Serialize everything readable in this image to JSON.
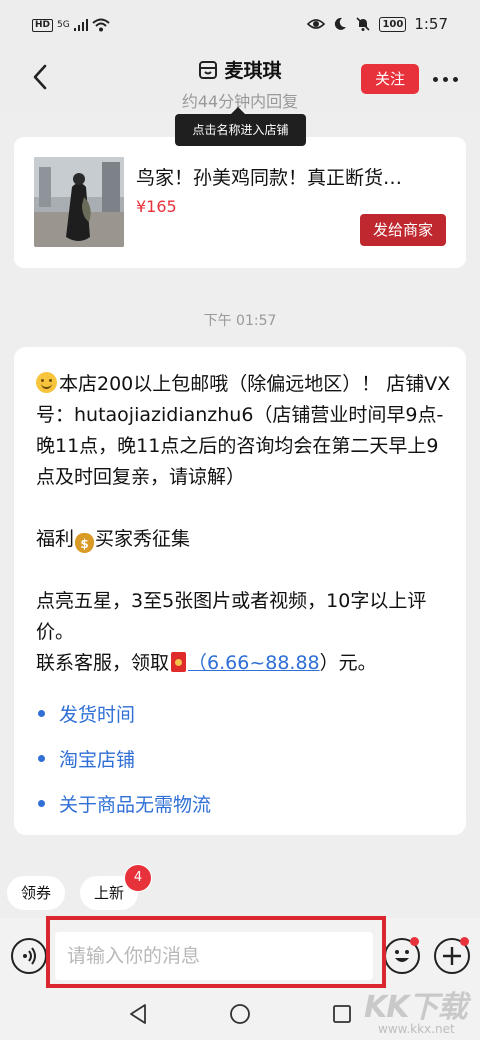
{
  "status_bar": {
    "left_tags": [
      "HD",
      "5G"
    ],
    "battery": "100",
    "time": "1:57"
  },
  "header": {
    "back_icon": "chevron-left-icon",
    "shop_icon": "store-icon",
    "shop_name": "麦琪琪",
    "reply_time": "约44分钟内回复",
    "follow_label": "关注",
    "more_icon": "more-dots-icon"
  },
  "tooltip": "点击名称进入店铺",
  "product": {
    "title": "鸟家！孙美鸡同款！真正断货…",
    "price": "¥165",
    "send_label": "发给商家"
  },
  "timestamp": "下午 01:57",
  "message": {
    "p1_text": "本店200以上包邮哦（除偏远地区）！ 店铺VX号：hutaojiazidianzhu6（店铺营业时间早9点-晚11点，晚11点之后的咨询均会在第二天早上9点及时回复亲，请谅解）",
    "p2_prefix": "福利",
    "p2_suffix": "买家秀征集",
    "p3_line1": "点亮五星，3至5张图片或者视频，10字以上评价。",
    "p3_line2_prefix": "联系客服，领取",
    "p3_amount": "（6.66~88.88",
    "p3_line2_suffix": "）元。",
    "links": [
      "发货时间",
      "淘宝店铺",
      "关于商品无需物流"
    ]
  },
  "quick_chips": {
    "coupon": "领券",
    "new_arrivals": "上新",
    "new_badge": "4"
  },
  "input_bar": {
    "placeholder": "请输入你的消息",
    "voice_icon": "voice-icon",
    "emoji_icon": "emoji-icon",
    "plus_icon": "plus-icon"
  },
  "nav_bar": {
    "back_icon": "triangle-back-icon",
    "home_icon": "circle-home-icon",
    "recent_icon": "square-recent-icon"
  },
  "watermark": {
    "main": "KK下载",
    "sub": "www.kkx.net"
  },
  "colors": {
    "accent_red": "#e8323b",
    "link_blue": "#2f6fd6",
    "highlight_red": "#d9262f"
  }
}
